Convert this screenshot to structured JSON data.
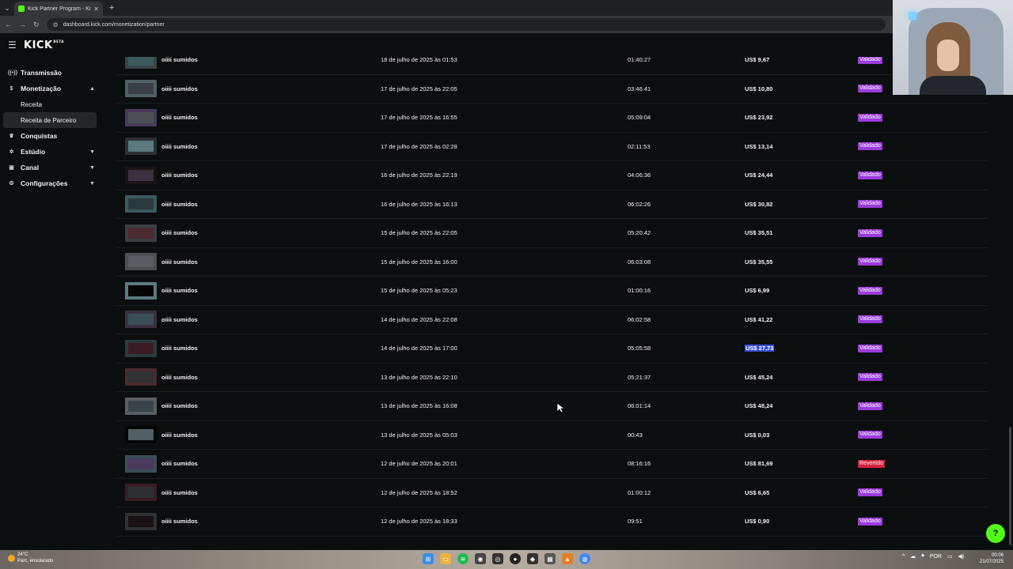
{
  "browser": {
    "tab_title": "Kick Partner Program - Kick Da",
    "url": "dashboard.kick.com/monetization/partner"
  },
  "header": {
    "logo": "KICK",
    "logo_badge": "BETA"
  },
  "sidebar": {
    "items": [
      {
        "label": "Transmissão",
        "icon": "broadcast-icon"
      },
      {
        "label": "Monetização",
        "icon": "dollar-icon",
        "expanded": true,
        "children": [
          {
            "label": "Receita"
          },
          {
            "label": "Receita de Parceiro",
            "active": true
          }
        ]
      },
      {
        "label": "Conquistas",
        "icon": "trophy-icon"
      },
      {
        "label": "Estúdio",
        "icon": "studio-icon"
      },
      {
        "label": "Canal",
        "icon": "channel-icon"
      },
      {
        "label": "Configurações",
        "icon": "gear-icon"
      }
    ]
  },
  "table": {
    "rows": [
      {
        "title": "oiiii sumidos",
        "date": "18 de julho de 2025 às 01:53",
        "duration": "01:40:27",
        "amount": "US$ 9,67",
        "status": "Validado"
      },
      {
        "title": "oiiii sumidos",
        "date": "17 de julho de 2025 às 22:05",
        "duration": "03:46:41",
        "amount": "US$ 10,80",
        "status": "Validado"
      },
      {
        "title": "oiiii sumidos",
        "date": "17 de julho de 2025 às 16:55",
        "duration": "05:09:04",
        "amount": "US$ 23,92",
        "status": "Validado"
      },
      {
        "title": "oiiii sumidos",
        "date": "17 de julho de 2025 às 02:28",
        "duration": "02:11:53",
        "amount": "US$ 13,14",
        "status": "Validado"
      },
      {
        "title": "oiiii sumidos",
        "date": "16 de julho de 2025 às 22:19",
        "duration": "04:06:36",
        "amount": "US$ 24,44",
        "status": "Validado"
      },
      {
        "title": "oiiii sumidos",
        "date": "16 de julho de 2025 às 16:13",
        "duration": "06:02:26",
        "amount": "US$ 30,82",
        "status": "Validado"
      },
      {
        "title": "oiiii sumidos",
        "date": "15 de julho de 2025 às 22:05",
        "duration": "05:20:42",
        "amount": "US$ 35,51",
        "status": "Validado"
      },
      {
        "title": "oiiii sumidos",
        "date": "15 de julho de 2025 às 16:00",
        "duration": "06:03:08",
        "amount": "US$ 35,55",
        "status": "Validado"
      },
      {
        "title": "oiiii sumidos",
        "date": "15 de julho de 2025 às 05:23",
        "duration": "01:00:16",
        "amount": "US$ 6,99",
        "status": "Validado"
      },
      {
        "title": "oiiii sumidos",
        "date": "14 de julho de 2025 às 22:08",
        "duration": "06:02:58",
        "amount": "US$ 41,22",
        "status": "Validado"
      },
      {
        "title": "oiiii sumidos",
        "date": "14 de julho de 2025 às 17:00",
        "duration": "05:05:58",
        "amount": "US$ 27,73",
        "status": "Validado",
        "selected": true
      },
      {
        "title": "oiiii sumidos",
        "date": "13 de julho de 2025 às 22:10",
        "duration": "05:21:37",
        "amount": "US$ 45,24",
        "status": "Validado"
      },
      {
        "title": "oiiii sumidos",
        "date": "13 de julho de 2025 às 16:08",
        "duration": "06:01:14",
        "amount": "US$ 48,24",
        "status": "Validado"
      },
      {
        "title": "oiiii sumidos",
        "date": "13 de julho de 2025 às 05:03",
        "duration": "00:43",
        "amount": "US$ 0,03",
        "status": "Validado"
      },
      {
        "title": "oiiii sumidos",
        "date": "12 de julho de 2025 às 20:01",
        "duration": "08:16:16",
        "amount": "US$ 81,69",
        "status": "Revertido"
      },
      {
        "title": "oiiii sumidos",
        "date": "12 de julho de 2025 às 18:52",
        "duration": "01:00:12",
        "amount": "US$ 6,65",
        "status": "Validado"
      },
      {
        "title": "oiiii sumidos",
        "date": "12 de julho de 2025 às 18:33",
        "duration": "09:51",
        "amount": "US$ 0,90",
        "status": "Validado"
      }
    ]
  },
  "colors": {
    "accent": "#53fc18",
    "validado": "#9b3bdc",
    "revertido": "#d8213c",
    "background": "#0b0e0f"
  },
  "taskbar": {
    "weather_temp": "24°C",
    "weather_desc": "Parc. ensolarado",
    "language": "POR",
    "time": "00:06",
    "date": "21/07/2025"
  }
}
